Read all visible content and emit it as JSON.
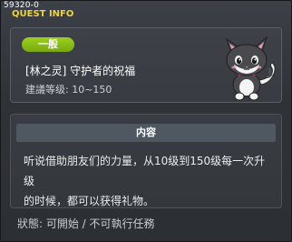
{
  "window": {
    "quest_id": "59320-0",
    "title": "QUEST INFO"
  },
  "quest": {
    "category": "一般",
    "name": "[林之灵] 守护者的祝福",
    "level": "建議等级: 10~150"
  },
  "content": {
    "header": "内容",
    "text_line1": "听说借助朋友们的力量，从10级到150级每一次升级",
    "text_line2": "的时候，都可以获得礼物。"
  },
  "status": "狀態: 可開始 / 不可執行任務"
}
